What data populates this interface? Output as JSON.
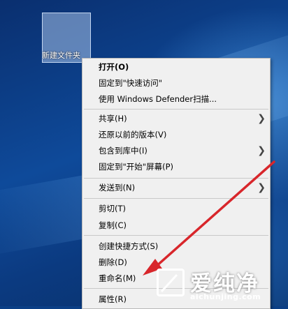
{
  "desktop": {
    "folder_label": "新建文件夹"
  },
  "context_menu": {
    "items": [
      {
        "label": "打开(O)",
        "bold": true,
        "submenu": false
      },
      {
        "label": "固定到\"快速访问\"",
        "bold": false,
        "submenu": false
      },
      {
        "label": "使用 Windows Defender扫描...",
        "bold": false,
        "submenu": false
      },
      {
        "label": "共享(H)",
        "bold": false,
        "submenu": true
      },
      {
        "label": "还原以前的版本(V)",
        "bold": false,
        "submenu": false
      },
      {
        "label": "包含到库中(I)",
        "bold": false,
        "submenu": true
      },
      {
        "label": "固定到\"开始\"屏幕(P)",
        "bold": false,
        "submenu": false
      },
      {
        "label": "发送到(N)",
        "bold": false,
        "submenu": true
      },
      {
        "label": "剪切(T)",
        "bold": false,
        "submenu": false
      },
      {
        "label": "复制(C)",
        "bold": false,
        "submenu": false
      },
      {
        "label": "创建快捷方式(S)",
        "bold": false,
        "submenu": false
      },
      {
        "label": "删除(D)",
        "bold": false,
        "submenu": false
      },
      {
        "label": "重命名(M)",
        "bold": false,
        "submenu": false
      },
      {
        "label": "属性(R)",
        "bold": false,
        "submenu": false
      }
    ]
  },
  "watermark": {
    "brand": "爱纯净",
    "url": "aichunjing.com"
  },
  "colors": {
    "annotation_arrow": "#d8262b",
    "menu_bg": "#f0f0f0"
  }
}
